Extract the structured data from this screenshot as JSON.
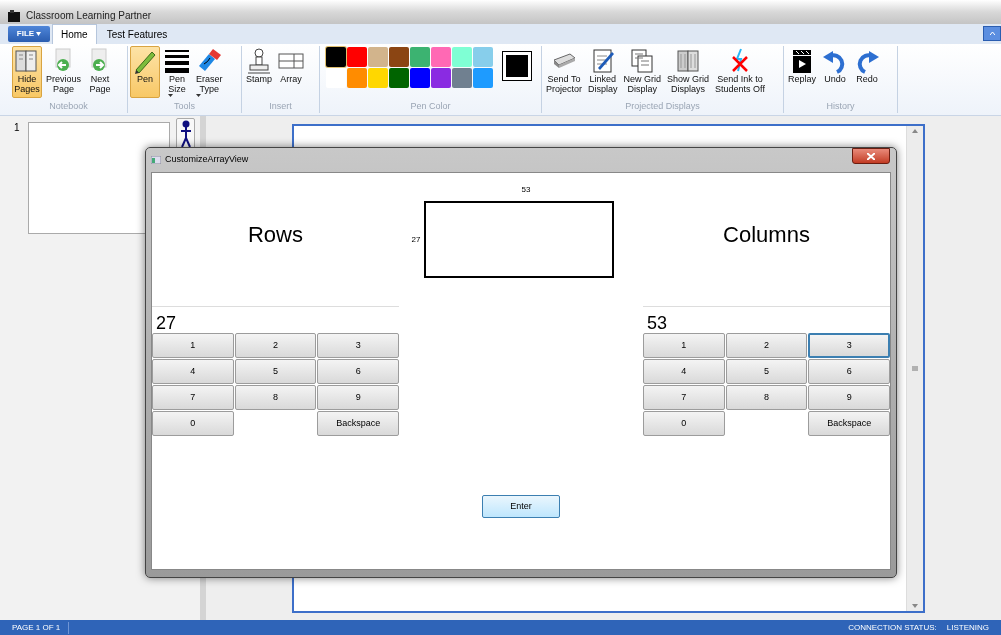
{
  "window": {
    "title": "Classroom Learning Partner"
  },
  "ribbon": {
    "file_menu": "FILE",
    "tabs": [
      {
        "label": "Home",
        "selected": true
      },
      {
        "label": "Test Features",
        "selected": false
      }
    ],
    "groups": [
      {
        "kind": "buttons",
        "label": "Notebook",
        "buttons": [
          {
            "label": "Hide Pages",
            "selected": true,
            "dropdown": false
          },
          {
            "label": "Previous Page",
            "selected": false,
            "dropdown": false
          },
          {
            "label": "Next Page",
            "selected": false,
            "dropdown": false
          }
        ]
      },
      {
        "kind": "buttons",
        "label": "Tools",
        "buttons": [
          {
            "label": "Pen",
            "selected": true,
            "dropdown": false
          },
          {
            "label": "Pen Size",
            "selected": false,
            "dropdown": true
          },
          {
            "label": "Eraser Type",
            "selected": false,
            "dropdown": true
          }
        ]
      },
      {
        "kind": "buttons",
        "label": "Insert",
        "buttons": [
          {
            "label": "Stamp",
            "selected": false,
            "dropdown": false
          },
          {
            "label": "Array",
            "selected": false,
            "dropdown": false
          }
        ]
      },
      {
        "kind": "colors",
        "label": "Pen Color",
        "swatches": [
          {
            "color": "#000000",
            "selected": true
          },
          {
            "color": "#ff0000",
            "selected": false
          },
          {
            "color": "#d2b48c",
            "selected": false
          },
          {
            "color": "#8b4513",
            "selected": false
          },
          {
            "color": "#3cb371",
            "selected": false
          },
          {
            "color": "#ff69b4",
            "selected": false
          },
          {
            "color": "#7fffd4",
            "selected": false
          },
          {
            "color": "#87ceeb",
            "selected": false
          },
          {
            "color": "#ffffff",
            "selected": false
          },
          {
            "color": "#ff8c00",
            "selected": false
          },
          {
            "color": "#ffd700",
            "selected": false
          },
          {
            "color": "#006400",
            "selected": false
          },
          {
            "color": "#0000ff",
            "selected": false
          },
          {
            "color": "#8a2be2",
            "selected": false
          },
          {
            "color": "#708090",
            "selected": false
          },
          {
            "color": "#1e9bff",
            "selected": false
          }
        ]
      },
      {
        "kind": "buttons",
        "label": "Projected Displays",
        "buttons": [
          {
            "label": "Send To Projector",
            "selected": false,
            "dropdown": false
          },
          {
            "label": "Linked Display",
            "selected": false,
            "dropdown": false
          },
          {
            "label": "New Grid Display",
            "selected": false,
            "dropdown": false
          },
          {
            "label": "Show Grid Displays",
            "selected": false,
            "dropdown": false
          },
          {
            "label": "Send Ink to Students Off",
            "selected": false,
            "dropdown": false
          }
        ]
      },
      {
        "kind": "buttons",
        "label": "History",
        "buttons": [
          {
            "label": "Replay",
            "selected": false,
            "dropdown": false
          },
          {
            "label": "Undo",
            "selected": false,
            "dropdown": false
          },
          {
            "label": "Redo",
            "selected": false,
            "dropdown": false
          }
        ]
      }
    ]
  },
  "page_list": [
    {
      "number": "1"
    }
  ],
  "dialog": {
    "title": "CustomizeArrayView",
    "rows_label": "Rows",
    "columns_label": "Columns",
    "preview": {
      "columns": "53",
      "rows": "27"
    },
    "keypads": [
      {
        "value": "27",
        "keys": [
          {
            "label": "1",
            "focused": false
          },
          {
            "label": "2",
            "focused": false
          },
          {
            "label": "3",
            "focused": false
          },
          {
            "label": "4",
            "focused": false
          },
          {
            "label": "5",
            "focused": false
          },
          {
            "label": "6",
            "focused": false
          },
          {
            "label": "7",
            "focused": false
          },
          {
            "label": "8",
            "focused": false
          },
          {
            "label": "9",
            "focused": false
          },
          {
            "label": "0",
            "focused": false
          },
          {
            "label": "Backspace",
            "focused": false
          }
        ]
      },
      {
        "value": "53",
        "keys": [
          {
            "label": "1",
            "focused": false
          },
          {
            "label": "2",
            "focused": false
          },
          {
            "label": "3",
            "focused": true
          },
          {
            "label": "4",
            "focused": false
          },
          {
            "label": "5",
            "focused": false
          },
          {
            "label": "6",
            "focused": false
          },
          {
            "label": "7",
            "focused": false
          },
          {
            "label": "8",
            "focused": false
          },
          {
            "label": "9",
            "focused": false
          },
          {
            "label": "0",
            "focused": false
          },
          {
            "label": "Backspace",
            "focused": false
          }
        ]
      }
    ],
    "enter_button": "Enter"
  },
  "status_bar": {
    "page": "PAGE 1 OF 1",
    "connection_label": "CONNECTION STATUS:",
    "connection_value": "LISTENING"
  }
}
